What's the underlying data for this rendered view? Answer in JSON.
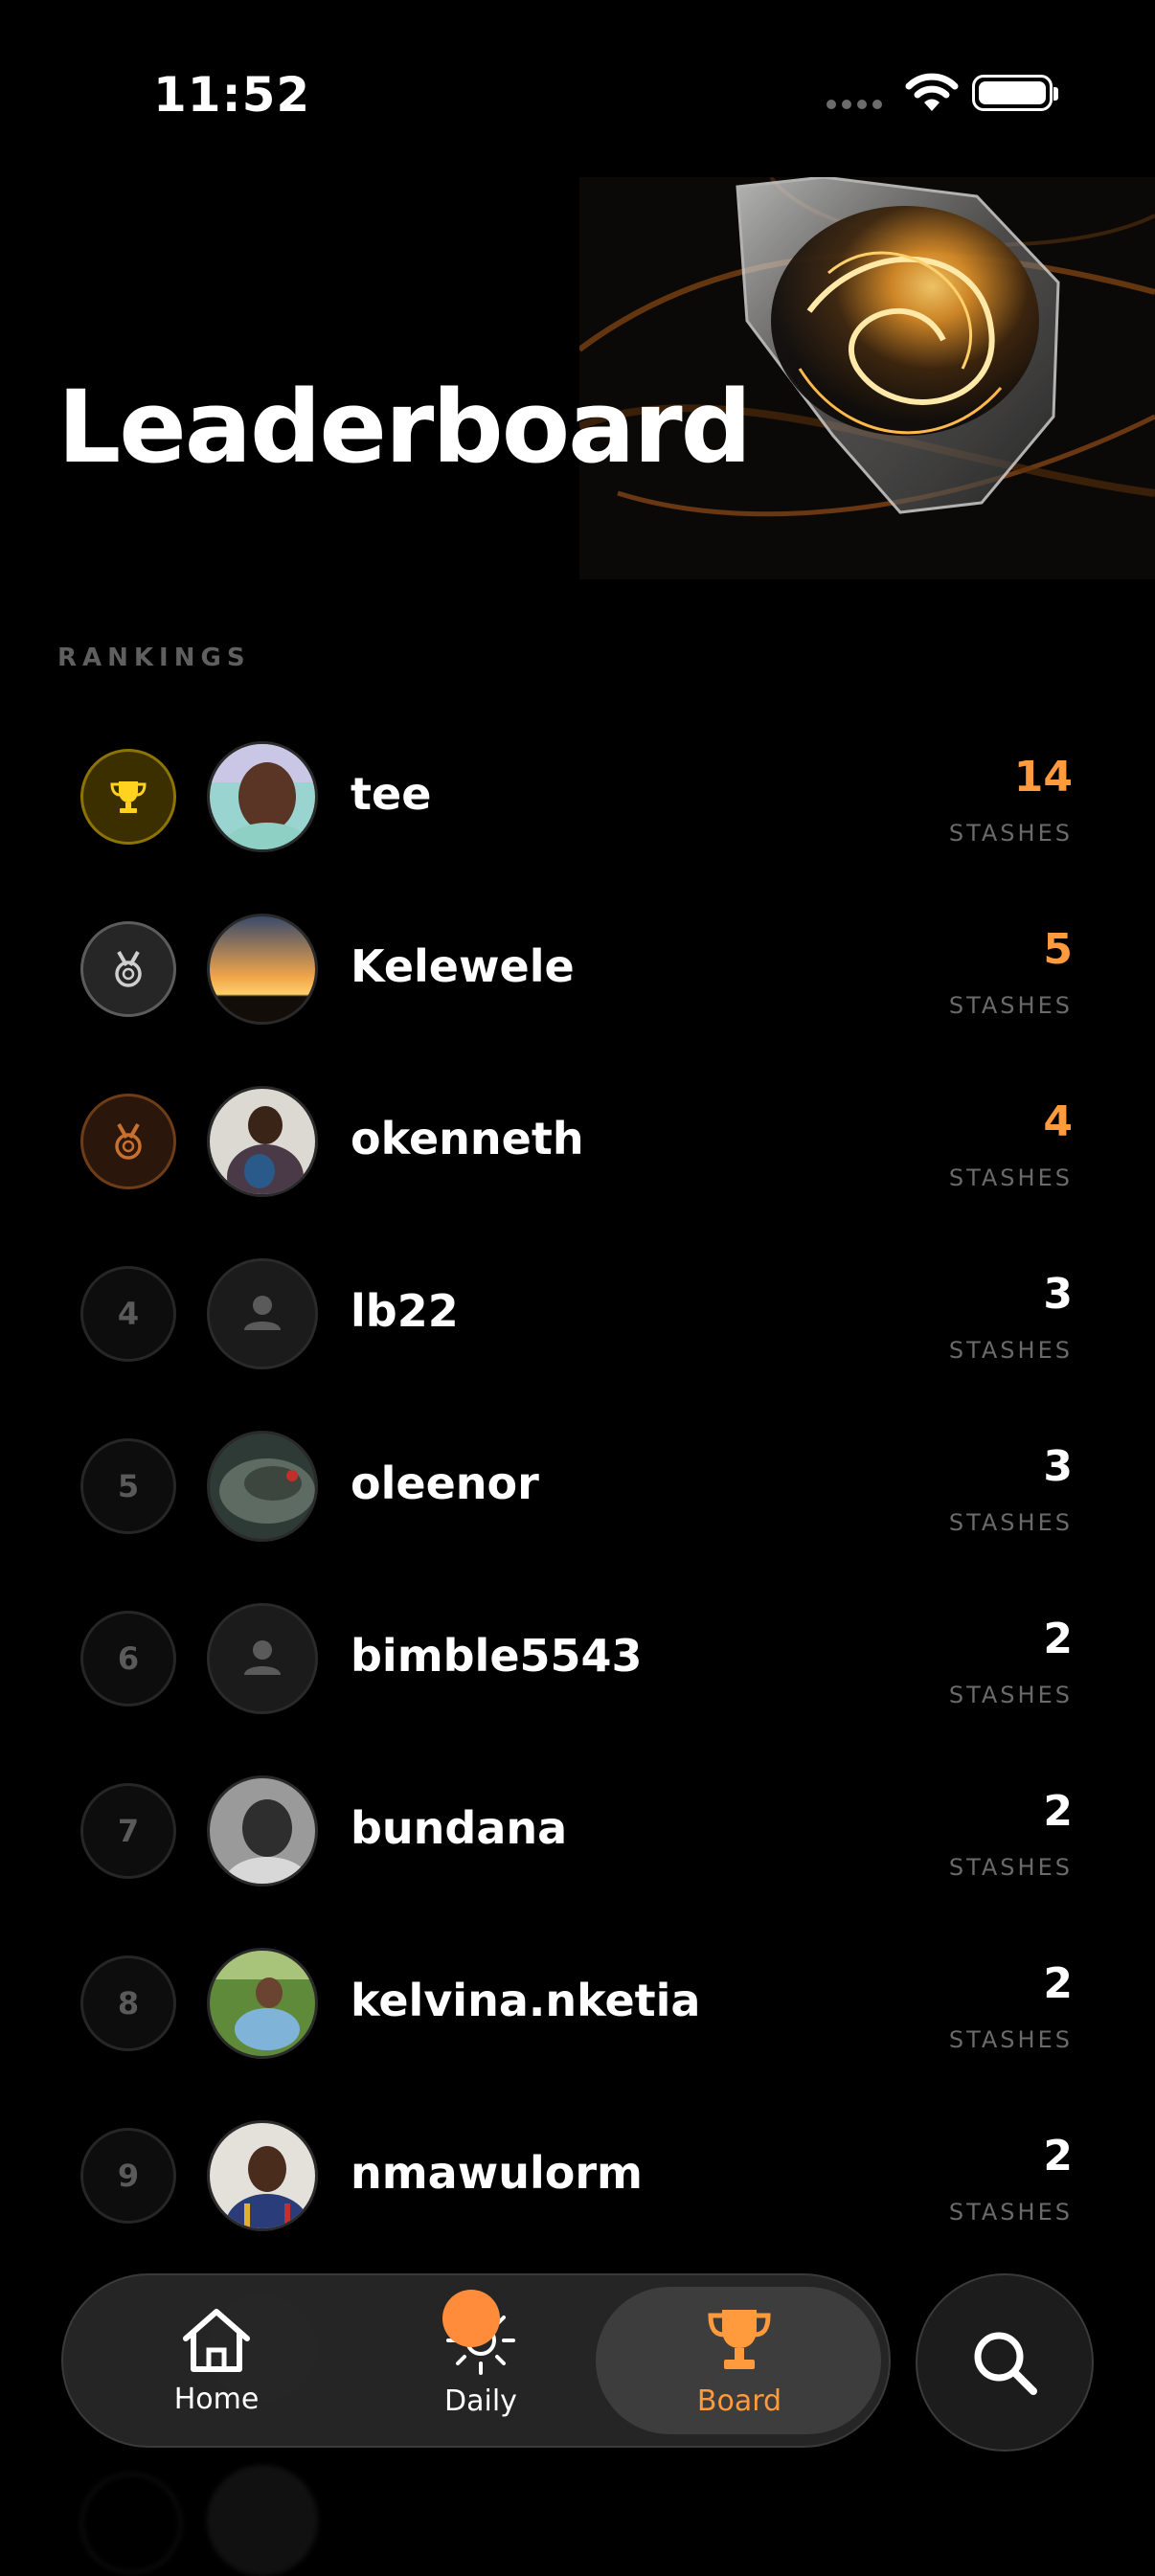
{
  "status_bar": {
    "time": "11:52"
  },
  "header": {
    "title": "Leaderboard"
  },
  "section": {
    "label": "RANKINGS"
  },
  "rankings": [
    {
      "rank": "",
      "medal": "trophy-icon",
      "name": "tee",
      "score": "14",
      "unit": "STASHES"
    },
    {
      "rank": "",
      "medal": "medal-icon",
      "name": "Kelewele",
      "score": "5",
      "unit": "STASHES"
    },
    {
      "rank": "",
      "medal": "medal-icon",
      "name": "okenneth",
      "score": "4",
      "unit": "STASHES"
    },
    {
      "rank": "4",
      "name": "lb22",
      "score": "3",
      "unit": "STASHES"
    },
    {
      "rank": "5",
      "name": "oleenor",
      "score": "3",
      "unit": "STASHES"
    },
    {
      "rank": "6",
      "name": "bimble5543",
      "score": "2",
      "unit": "STASHES"
    },
    {
      "rank": "7",
      "name": "bundana",
      "score": "2",
      "unit": "STASHES"
    },
    {
      "rank": "8",
      "name": "kelvina.nketia",
      "score": "2",
      "unit": "STASHES"
    },
    {
      "rank": "9",
      "name": "nmawulorm",
      "score": "2",
      "unit": "STASHES"
    }
  ],
  "tabs": [
    {
      "label": "Home",
      "icon": "home-icon"
    },
    {
      "label": "Daily",
      "icon": "sun-icon"
    },
    {
      "label": "Board",
      "icon": "trophy-icon"
    }
  ],
  "colors": {
    "accent": "#ff9a3d",
    "gold": "#ffd21f",
    "silver": "#cfcfcf",
    "bronze": "#c9702d"
  }
}
